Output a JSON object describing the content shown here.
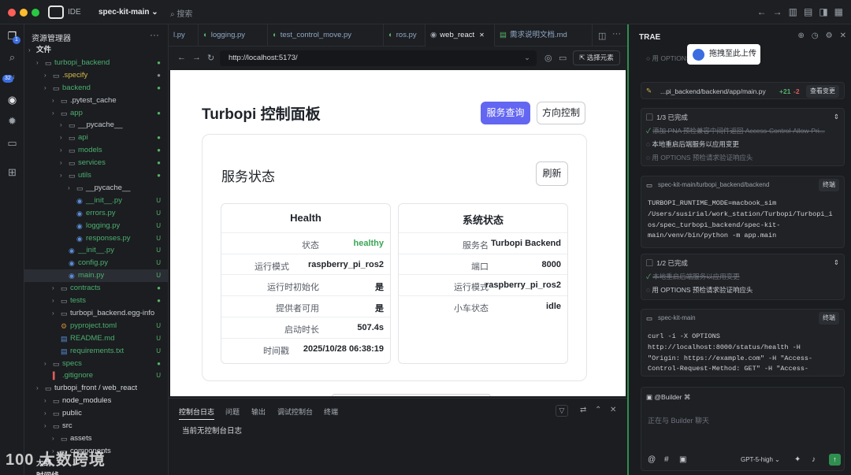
{
  "titlebar": {
    "ide": "IDE",
    "project": "spec-kit-main",
    "search": "搜索"
  },
  "activity": {
    "badge1": "1",
    "badge2": "32"
  },
  "explorer": {
    "title": "资源管理器",
    "more": "···",
    "tree": [
      {
        "l": "文件",
        "d": 0,
        "t": "arrow",
        "c": "#d6d9de"
      },
      {
        "l": "turbopi_backend",
        "d": 1,
        "t": "folder",
        "c": "#4caf70",
        "s": "●"
      },
      {
        "l": ".specify",
        "d": 2,
        "t": "folder",
        "c": "#d6b94a",
        "s": "●",
        "sc": "#8a9099"
      },
      {
        "l": "backend",
        "d": 2,
        "t": "folder",
        "c": "#4caf70",
        "s": "●"
      },
      {
        "l": ".pytest_cache",
        "d": 3,
        "t": "folder",
        "c": "#c7cbd1"
      },
      {
        "l": "app",
        "d": 3,
        "t": "folder",
        "c": "#4caf70",
        "s": "●"
      },
      {
        "l": "__pycache__",
        "d": 4,
        "t": "folder",
        "c": "#c7cbd1"
      },
      {
        "l": "api",
        "d": 4,
        "t": "folder",
        "c": "#4caf70",
        "s": "●"
      },
      {
        "l": "models",
        "d": 4,
        "t": "folder",
        "c": "#4caf70",
        "s": "●"
      },
      {
        "l": "services",
        "d": 4,
        "t": "folder",
        "c": "#4caf70",
        "s": "●"
      },
      {
        "l": "utils",
        "d": 4,
        "t": "folder",
        "c": "#4caf70",
        "s": "●"
      },
      {
        "l": "__pycache__",
        "d": 5,
        "t": "folder",
        "c": "#c7cbd1"
      },
      {
        "l": "__init__.py",
        "d": 5,
        "t": "py",
        "c": "#4caf70",
        "s": "U"
      },
      {
        "l": "errors.py",
        "d": 5,
        "t": "py",
        "c": "#4caf70",
        "s": "U"
      },
      {
        "l": "logging.py",
        "d": 5,
        "t": "py",
        "c": "#4caf70",
        "s": "U"
      },
      {
        "l": "responses.py",
        "d": 5,
        "t": "py",
        "c": "#4caf70",
        "s": "U"
      },
      {
        "l": "__init__.py",
        "d": 4,
        "t": "py",
        "c": "#4caf70",
        "s": "U"
      },
      {
        "l": "config.py",
        "d": 4,
        "t": "py",
        "c": "#4caf70",
        "s": "U"
      },
      {
        "l": "main.py",
        "d": 4,
        "t": "py",
        "c": "#4caf70",
        "s": "U",
        "sel": true
      },
      {
        "l": "contracts",
        "d": 3,
        "t": "folder",
        "c": "#4caf70",
        "s": "●"
      },
      {
        "l": "tests",
        "d": 3,
        "t": "folder",
        "c": "#4caf70",
        "s": "●"
      },
      {
        "l": "turbopi_backend.egg-info",
        "d": 3,
        "t": "folder",
        "c": "#c7cbd1"
      },
      {
        "l": "pyproject.toml",
        "d": 3,
        "t": "cfg",
        "c": "#4caf70",
        "s": "U"
      },
      {
        "l": "README.md",
        "d": 3,
        "t": "md",
        "c": "#4caf70",
        "s": "U"
      },
      {
        "l": "requirements.txt",
        "d": 3,
        "t": "txt",
        "c": "#4caf70",
        "s": "U"
      },
      {
        "l": "specs",
        "d": 2,
        "t": "folder",
        "c": "#4caf70",
        "s": "●"
      },
      {
        "l": ".gitignore",
        "d": 2,
        "t": "git",
        "c": "#4caf70",
        "s": "U"
      },
      {
        "l": "turbopi_front / web_react",
        "d": 1,
        "t": "folder",
        "c": "#d6d9de"
      },
      {
        "l": "node_modules",
        "d": 2,
        "t": "folder",
        "c": "#d6d9de"
      },
      {
        "l": "public",
        "d": 2,
        "t": "folder",
        "c": "#d6d9de"
      },
      {
        "l": "src",
        "d": 2,
        "t": "folder",
        "c": "#d6d9de"
      },
      {
        "l": "assets",
        "d": 3,
        "t": "folder",
        "c": "#d6d9de"
      },
      {
        "l": "components",
        "d": 3,
        "t": "folder",
        "c": "#d6d9de"
      },
      {
        "l": "大纲",
        "d": 0,
        "t": "arrow",
        "c": "#d6d9de"
      },
      {
        "l": "时间线",
        "d": 0,
        "t": "arrow",
        "c": "#d6d9de"
      }
    ]
  },
  "tabs": [
    {
      "label": "l.py",
      "icon": ""
    },
    {
      "label": "logging.py",
      "icon": "◐"
    },
    {
      "label": "test_control_move.py",
      "icon": "◐"
    },
    {
      "label": "ros.py",
      "icon": "◐"
    },
    {
      "label": "web_react",
      "icon": "◉",
      "active": true,
      "close": "✕"
    },
    {
      "label": "需求说明文档.md",
      "icon": "▤"
    }
  ],
  "browser": {
    "url": "http://localhost:5173/",
    "select_element": "选择元素"
  },
  "web": {
    "title": "Turbopi 控制面板",
    "btn_service": "服务查询",
    "btn_direction": "方向控制",
    "card_title": "服务状态",
    "refresh": "刷新",
    "health": {
      "title": "Health",
      "rows": [
        {
          "k": "状态",
          "v": "healthy",
          "color": "#3aa655"
        },
        {
          "k": "运行模式",
          "v": "raspberry_pi_ros2"
        },
        {
          "k": "运行时初始化",
          "v": "是"
        },
        {
          "k": "提供者可用",
          "v": "是"
        },
        {
          "k": "启动时长",
          "v": "507.4s"
        },
        {
          "k": "时间戳",
          "v": "2025/10/28 06:38:19"
        }
      ]
    },
    "system": {
      "title": "系统状态",
      "rows": [
        {
          "k": "服务名",
          "v": "Turbopi Backend"
        },
        {
          "k": "端口",
          "v": "8000"
        },
        {
          "k": "运行模式",
          "v": "raspberry_pi_ros2"
        },
        {
          "k": "小车状态",
          "v": "idle"
        }
      ]
    }
  },
  "bottom": {
    "tabs": [
      "控制台日志",
      "问题",
      "输出",
      "调试控制台",
      "终端"
    ],
    "message": "当前无控制台日志"
  },
  "trae": {
    "title": "TRAE",
    "drag": "拖拽至此上传",
    "options_hint": "用 OPTIONS",
    "change_file": "...pi_backend/backend/app/main.py",
    "plus": "+21",
    "minus": "-2",
    "view_changes": "查看变更",
    "task1": {
      "header": "1/3 已完成",
      "items": [
        "添加 PNA 预检兼容中间件返回 Access-Control-Allow-Pri...",
        "本地重启后端服务以应用变更",
        "用 OPTIONS 预检请求验证响应头"
      ]
    },
    "term1": {
      "path": "spec-kit-main/turbopi_backend/backend",
      "btn": "终端",
      "lines": [
        "TURBOPI_RUNTIME_MODE=macbook_sim",
        "/Users/susirial/work_station/Turbopi/Turbopi_i",
        "os/spec_turbopi_backend/spec-kit-",
        "main/venv/bin/python -m app.main"
      ]
    },
    "task2": {
      "header": "1/2 已完成",
      "items": [
        "本地重启后端服务以应用变更",
        "用 OPTIONS 预检请求验证响应头"
      ]
    },
    "term2": {
      "path": "spec-kit-main",
      "btn": "终端",
      "lines": [
        "curl -i -X OPTIONS",
        "http://localhost:8000/status/health -H",
        "\"Origin: https://example.com\" -H \"Access-",
        "Control-Request-Method: GET\" -H \"Access-"
      ]
    },
    "builder": "@Builder",
    "placeholder": "正在与 Builder 聊天",
    "model": "GPT-5-high"
  },
  "watermark": "100 大数跨境"
}
